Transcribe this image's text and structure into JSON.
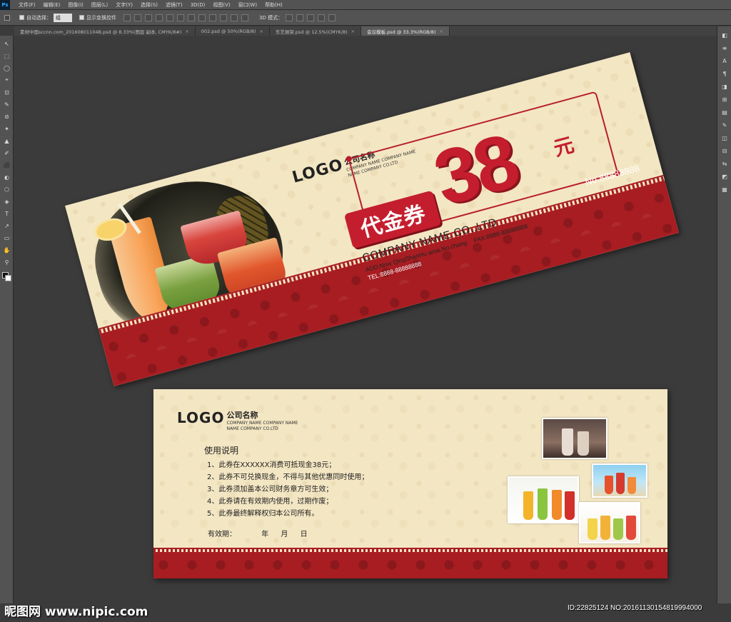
{
  "app": {
    "logo": "Ps",
    "menu": [
      "文件(F)",
      "编辑(E)",
      "图像(I)",
      "图层(L)",
      "文字(Y)",
      "选择(S)",
      "滤镜(T)",
      "3D(D)",
      "视图(V)",
      "窗口(W)",
      "帮助(H)"
    ],
    "options": {
      "auto_select_label": "自动选择：",
      "auto_select_value": "组",
      "show_transform_label": "显示变换控件",
      "mode_3d_label": "3D 模式："
    },
    "tabs": [
      {
        "label": "素材中国sccnn.com_20160801104B.psd @ 8.33%(图层 副本, CMYK/8#)",
        "active": false
      },
      {
        "label": "002.psd @ 50%(RGB/8)",
        "active": false
      },
      {
        "label": "东艺展架.psd @ 12.5%(CMYK/8)",
        "active": false
      },
      {
        "label": "会议模板.psd @ 33.3%(RGB/8)",
        "active": true
      }
    ],
    "close_glyph": "×",
    "tools": [
      "↖",
      "⬚",
      "◯",
      "⌖",
      "⊡",
      "✎",
      "⊘",
      "✦",
      "▲",
      "✐",
      "⬛",
      "◐",
      "⬡",
      "◈",
      "T",
      "↗",
      "▭",
      "✋",
      "⚲"
    ],
    "panel_icons": [
      "◧",
      "≡",
      "A",
      "¶",
      "◨",
      "⊞",
      "▤",
      "✎",
      "◫",
      "⊟",
      "⇆",
      "◩",
      "▦"
    ]
  },
  "front_voucher": {
    "logo": "LOGO",
    "company_cn": "公司名称",
    "company_en_1": "COMPANY NAME COMPANY NAME",
    "company_en_2": "NAME COMPANY CO.LTD",
    "badge": "代金券",
    "amount": "38",
    "unit": "元",
    "company_name": "COMPANY NAME CO.,LTD",
    "address": "ADD:Now QingShanHu aroa.No.chang",
    "fax": "FAX:8888-88888888",
    "tel": "TEL:8888-88888888",
    "serial": "No.88888888"
  },
  "back_voucher": {
    "logo": "LOGO",
    "company_cn": "公司名称",
    "company_en_1": "COMPANY NAME COMPANY NAME",
    "company_en_2": "NAME COMPANY CO.LTD",
    "instructions_title": "使用说明",
    "rules": [
      "1、此券在XXXXXX消费可抵现金38元；",
      "2、此券不可兑换现金，不得与其他优惠同时使用；",
      "3、此券须加盖本公司财务章方可生效；",
      "4、此券请在有效期内使用，过期作废；",
      "5、此券最终解释权归本公司所有。"
    ],
    "validity_label": "有效期：",
    "validity_year": "年",
    "validity_month": "月",
    "validity_day": "日"
  },
  "watermark": {
    "left": "昵图网 www.nipic.com",
    "right": "ID:22825124 NO:20161130154819994000"
  },
  "colors": {
    "brand_red": "#c41e2e",
    "band_red": "#a81d22",
    "paper": "#f3e6c3",
    "workspace": "#3b3b3b"
  }
}
